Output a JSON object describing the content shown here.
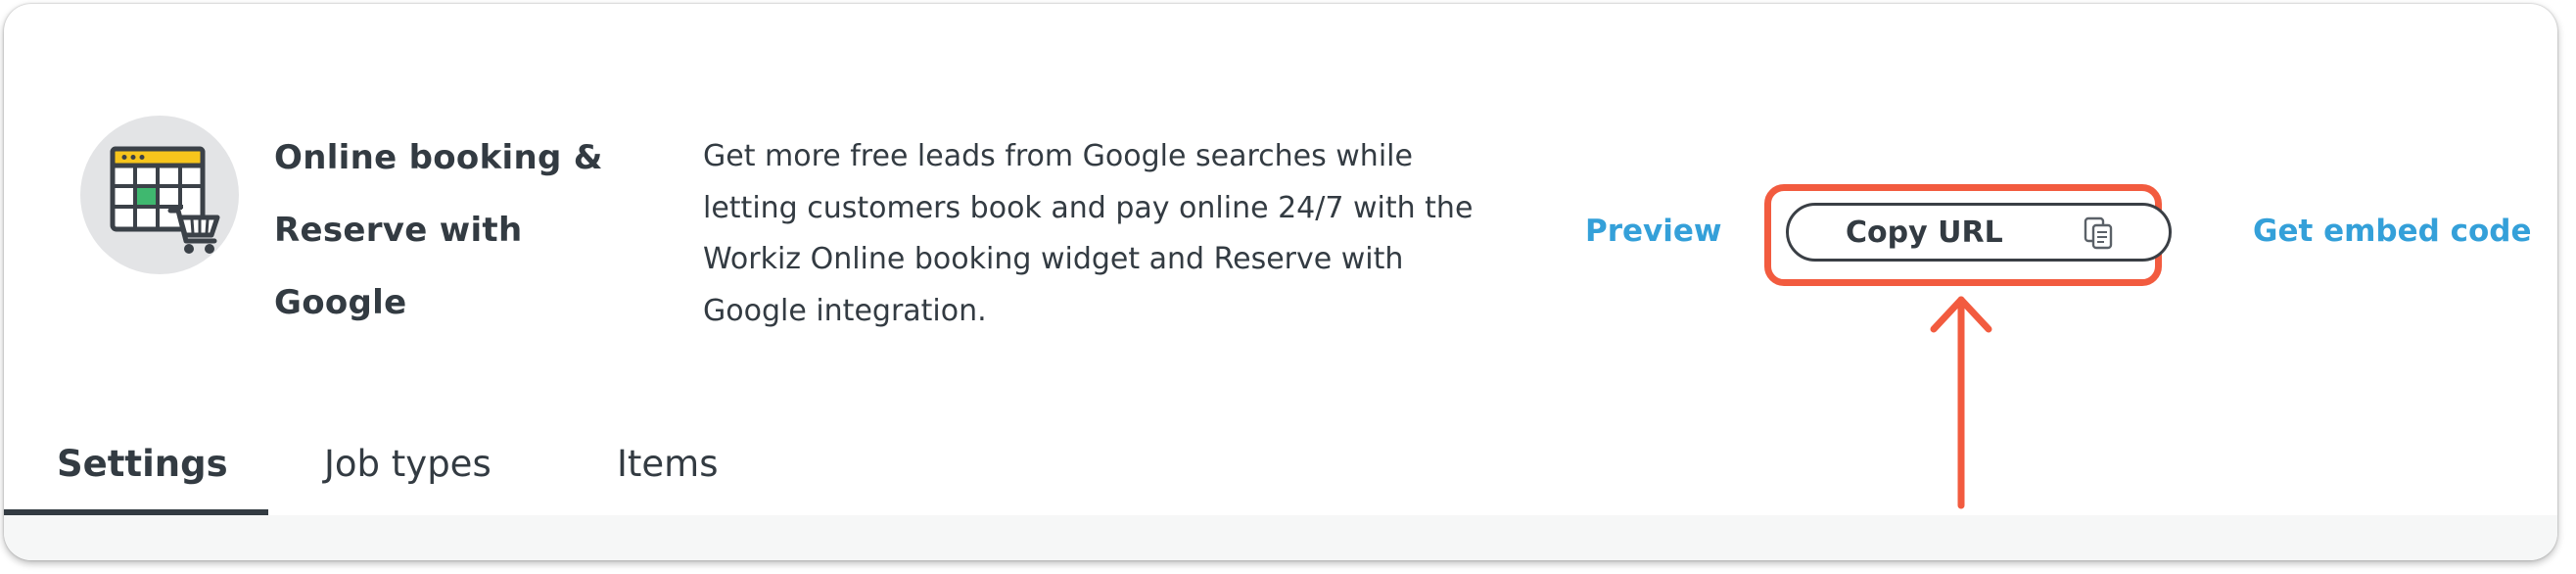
{
  "integration": {
    "title_line1": "Online booking &",
    "title_line2": "Reserve with Google",
    "description": "Get more free leads from Google searches while letting customers book and pay online 24/7 with the Workiz Online booking widget and Reserve with Google integration.",
    "icon": "calendar-cart-icon"
  },
  "actions": {
    "preview_label": "Preview",
    "copy_url_label": "Copy URL",
    "copy_icon": "copy-icon",
    "embed_label": "Get embed code"
  },
  "tabs": [
    {
      "label": "Settings",
      "active": true
    },
    {
      "label": "Job types",
      "active": false
    },
    {
      "label": "Items",
      "active": false
    }
  ],
  "colors": {
    "link": "#34a0d9",
    "text": "#333b42",
    "highlight": "#f25b3f",
    "calendar_header": "#f7c51c",
    "calendar_cell": "#3fb86f",
    "logo_background": "#e3e4e6"
  }
}
